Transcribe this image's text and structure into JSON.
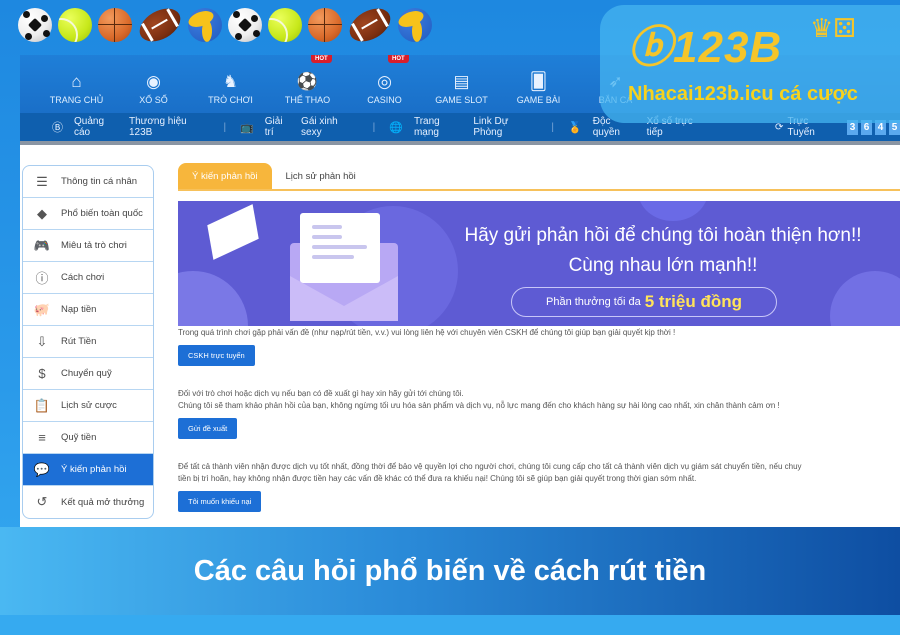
{
  "decor": {
    "balls": [
      "soccer-ball",
      "tennis-ball",
      "basketball",
      "american-football",
      "volleyball",
      "soccer-ball",
      "tennis-ball",
      "basketball",
      "american-football",
      "volleyball"
    ]
  },
  "logo": {
    "brand": "123B",
    "site": "Nhacai123b.icu cá cược",
    "accent": "#f5c52a"
  },
  "topnav": {
    "items": [
      {
        "label": "TRANG CHỦ",
        "icon": "home-icon",
        "glyph": "⌂",
        "hot": false
      },
      {
        "label": "XỔ SỐ",
        "icon": "lottery-ball-icon",
        "glyph": "◉",
        "hot": false
      },
      {
        "label": "TRÒ CHƠI",
        "icon": "chess-knight-icon",
        "glyph": "♞",
        "hot": false
      },
      {
        "label": "THỂ THAO",
        "icon": "soccer-icon",
        "glyph": "⚽",
        "hot": true
      },
      {
        "label": "CASINO",
        "icon": "roulette-icon",
        "glyph": "◎",
        "hot": true
      },
      {
        "label": "GAME SLOT",
        "icon": "slot-machine-icon",
        "glyph": "▤",
        "hot": false
      },
      {
        "label": "GAME BÀI",
        "icon": "cards-icon",
        "glyph": "🂠",
        "hot": false
      },
      {
        "label": "BẮN CÁ",
        "icon": "fish-icon",
        "glyph": "➶",
        "hot": false
      }
    ],
    "hot_label": "HOT"
  },
  "subnav": {
    "items": [
      {
        "icon": "brand-icon",
        "glyph": "Ⓑ",
        "label": "Quảng cáo",
        "value": "Thương hiệu 123B"
      },
      {
        "icon": "tv-icon",
        "glyph": "📺",
        "label": "Giải trí",
        "value": "Gái xinh sexy"
      },
      {
        "icon": "globe-icon",
        "glyph": "🌐",
        "label": "Trang mạng",
        "value": "Link Dự Phòng"
      },
      {
        "icon": "medal-icon",
        "glyph": "🏅",
        "label": "Độc quyền",
        "value": "Xổ số trực tiếp"
      }
    ],
    "online_label": "Trực Tuyến",
    "online_digits": [
      "3",
      "6",
      "4",
      "5"
    ]
  },
  "sidebar": {
    "items": [
      {
        "label": "Thông tin cá nhân",
        "icon": "user-card-icon",
        "glyph": "☰",
        "active": false
      },
      {
        "label": "Phổ biến toàn quốc",
        "icon": "diamond-icon",
        "glyph": "◆",
        "active": false
      },
      {
        "label": "Miêu tả trò chơi",
        "icon": "gamepad-icon",
        "glyph": "🎮",
        "active": false
      },
      {
        "label": "Cách chơi",
        "icon": "info-icon",
        "glyph": "ⓘ",
        "active": false
      },
      {
        "label": "Nạp tiền",
        "icon": "piggy-bank-icon",
        "glyph": "🐖",
        "active": false
      },
      {
        "label": "Rút Tiền",
        "icon": "withdraw-icon",
        "glyph": "⇩",
        "active": false
      },
      {
        "label": "Chuyển quỹ",
        "icon": "dollar-circle-icon",
        "glyph": "$",
        "active": false
      },
      {
        "label": "Lịch sử cược",
        "icon": "clipboard-icon",
        "glyph": "📋",
        "active": false
      },
      {
        "label": "Quỹ tiền",
        "icon": "coins-icon",
        "glyph": "≡",
        "active": false
      },
      {
        "label": "Ý kiến phản hồi",
        "icon": "chat-bubble-icon",
        "glyph": "💬",
        "active": true
      },
      {
        "label": "Kết quả mở thưởng",
        "icon": "history-icon",
        "glyph": "↺",
        "active": false
      }
    ]
  },
  "main": {
    "tabs": [
      {
        "label": "Ý kiến phản hồi",
        "active": true
      },
      {
        "label": "Lịch sử phản hồi",
        "active": false
      }
    ],
    "banner": {
      "line1": "Hãy gửi phản hồi để chúng tôi hoàn thiện hơn!!",
      "line2": "Cùng nhau lớn mạnh!!",
      "reward_prefix": "Phần thưởng tối đa",
      "reward_value": "5 triệu đồng"
    },
    "section1": {
      "text": "Trong quá trình chơi gặp phải vấn đề (như nạp/rút tiền, v.v.) vui lòng liên hệ với chuyên viên CSKH để chúng tôi giúp bạn giải quyết kịp thời !",
      "button": "CSKH trực tuyến"
    },
    "section2": {
      "line1": "Đối với trò chơi hoặc dịch vụ nếu bạn có đề xuất gì hay xin hãy gửi tới chúng tôi.",
      "line2": "Chúng tôi sẽ tham khảo phản hồi của bạn, không ngừng tối ưu hóa sản phẩm và dịch vụ, nỗ lực mang đến cho khách hàng sự hài lòng cao nhất, xin chân thành cảm ơn !",
      "button": "Gửi đề xuất"
    },
    "section3": {
      "line1": "Để tất cả thành viên nhận được dịch vụ tốt nhất, đồng thời để bảo vệ quyền lợi cho người chơi, chúng tôi cung cấp cho tất cả thành viên dịch vụ giám sát chuyển tiền, nếu chuy",
      "line2": "tiền bị trì hoãn, hay không nhận được tiền hay các vấn đề khác có thể đưa ra khiếu nại! Chúng tôi sẽ giúp bạn giải quyết trong thời gian sớm nhất.",
      "button": "Tôi muốn khiếu nại"
    }
  },
  "caption": {
    "text": "Các câu hỏi phổ biến về cách rút tiền"
  }
}
